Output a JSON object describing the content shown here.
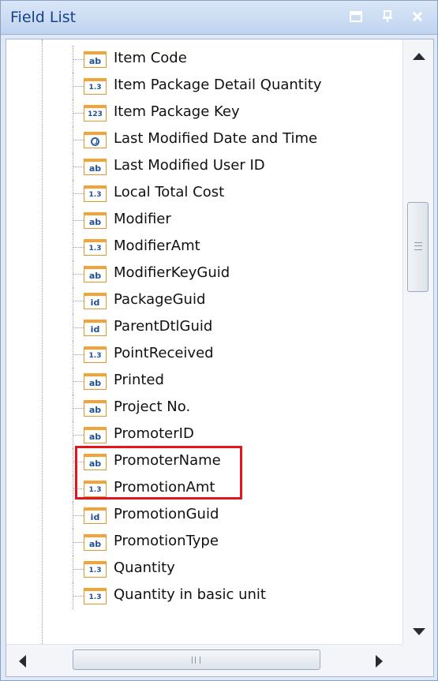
{
  "panel": {
    "title": "Field List",
    "buttons": [
      {
        "name": "maximize-icon"
      },
      {
        "name": "pin-icon"
      },
      {
        "name": "close-icon"
      }
    ]
  },
  "fields": [
    {
      "label": "Item Code",
      "type": "ab"
    },
    {
      "label": "Item Package Detail Quantity",
      "type": "1.3"
    },
    {
      "label": "Item Package Key",
      "type": "123"
    },
    {
      "label": "Last Modified Date and Time",
      "type": "clock"
    },
    {
      "label": "Last Modified User ID",
      "type": "ab"
    },
    {
      "label": "Local Total Cost",
      "type": "1.3"
    },
    {
      "label": "Modifier",
      "type": "ab"
    },
    {
      "label": "ModifierAmt",
      "type": "1.3"
    },
    {
      "label": "ModifierKeyGuid",
      "type": "ab"
    },
    {
      "label": "PackageGuid",
      "type": "id"
    },
    {
      "label": "ParentDtlGuid",
      "type": "id"
    },
    {
      "label": "PointReceived",
      "type": "1.3"
    },
    {
      "label": "Printed",
      "type": "ab"
    },
    {
      "label": "Project No.",
      "type": "ab"
    },
    {
      "label": "PromoterID",
      "type": "ab"
    },
    {
      "label": "PromoterName",
      "type": "ab"
    },
    {
      "label": "PromotionAmt",
      "type": "1.3"
    },
    {
      "label": "PromotionGuid",
      "type": "id"
    },
    {
      "label": "PromotionType",
      "type": "ab"
    },
    {
      "label": "Quantity",
      "type": "1.3"
    },
    {
      "label": "Quantity in basic unit",
      "type": "1.3"
    }
  ],
  "highlighted": [
    "PromoterID",
    "PromoterName"
  ],
  "colors": {
    "accent": "#15428b",
    "icon_border": "#e3962a",
    "highlight": "#e4141c"
  }
}
